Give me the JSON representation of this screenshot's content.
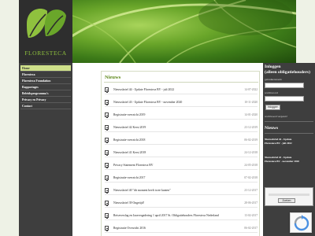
{
  "brand": {
    "name": "FLORESTECA",
    "accent": "#8fc13e"
  },
  "nav": {
    "items": [
      {
        "label": "Home",
        "active": true
      },
      {
        "label": "Floresteca"
      },
      {
        "label": "Floresteca Foundation"
      },
      {
        "label": "Rapportages"
      },
      {
        "label": "Beleidsprogramma's"
      },
      {
        "label": "Privacy en Privacy"
      },
      {
        "label": "Contact"
      }
    ]
  },
  "news": {
    "heading": "Nieuws",
    "items": [
      {
        "title": "Nieuwsbrief 44 - Update Floresteca BV - juli 2022",
        "date": "14-07-2022"
      },
      {
        "title": "Nieuwsbrief 43 - Update Floresteca BV - november 2020",
        "date": "10-11-2020"
      },
      {
        "title": "Registratie-overzicht 2019",
        "date": "14-01-2020"
      },
      {
        "title": "Nieuwsbrief 42 Kerst 2019",
        "date": "23-12-2019"
      },
      {
        "title": "Registratie-overzicht 2018",
        "date": "06-02-2019"
      },
      {
        "title": "Nieuwsbrief 41 Kerst 2018",
        "date": "24-12-2018"
      },
      {
        "title": "Privacy Statement Floresteca BV",
        "date": "24-05-2018"
      },
      {
        "title": "Registratie-overzicht 2017",
        "date": "07-02-2018"
      },
      {
        "title": "Nieuwsbrief 40 \"dit moment heeft twee kanten\"",
        "date": "23-12-2017"
      },
      {
        "title": "Nieuwsbrief 39 Ongetijd!",
        "date": "28-06-2017"
      },
      {
        "title": "Reiseverslag en Jaarvergadering 1 april 2017 St. Obligatiehouders Floresteca Nederland",
        "date": "13-02-2017"
      },
      {
        "title": "Registratie Overzicht 2016",
        "date": "06-02-2017"
      }
    ]
  },
  "login": {
    "title": "Inloggen",
    "subtitle": "(alleen obligatiehouders)",
    "username_label": "gebruikersnaam",
    "username_value": "",
    "password_label": "wachtwoord",
    "password_value": "",
    "button_label": "Inloggen",
    "forgot_label": "wachtwoord vergeten?"
  },
  "side_news": {
    "title": "Nieuws",
    "items": [
      {
        "line1": "Nieuwsbrief 44 - Update",
        "line2": "Floresteca BV - juli 2022"
      },
      {
        "line1": "Nieuwsbrief 43 - Update",
        "line2": "Floresteca BV - november 2020"
      }
    ]
  },
  "search": {
    "button_label": "Zoeken",
    "value": ""
  }
}
